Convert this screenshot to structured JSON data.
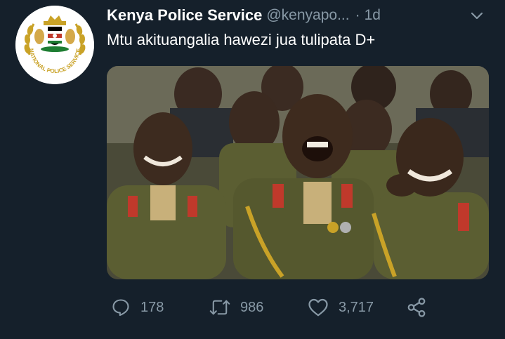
{
  "author": {
    "name": "Kenya Police Service",
    "handle": "@kenyapo...",
    "separator": "·",
    "time": "1d",
    "avatar_icon": "kenya-police-emblem",
    "avatar_ring_text": "NATIONAL POLICE SERVICE"
  },
  "tweet": {
    "text": "Mtu akituangalia hawezi jua tulipata D+"
  },
  "actions": {
    "reply_count": "178",
    "retweet_count": "986",
    "like_count": "3,717"
  },
  "colors": {
    "background": "#15202b",
    "secondary_text": "#8899a6",
    "primary_text": "#ffffff",
    "uniform_olive": "#5b5e32",
    "epaulette_red": "#c0392b",
    "emblem_gold": "#c9a227"
  }
}
